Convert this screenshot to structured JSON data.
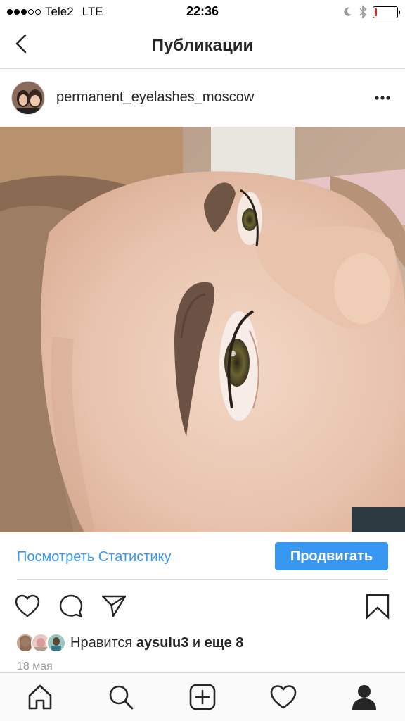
{
  "status_bar": {
    "carrier": "Tele2",
    "network": "LTE",
    "time": "22:36",
    "battery_level_percent": 10,
    "battery_color": "#e0231f"
  },
  "nav": {
    "back_icon": "chevron-left-icon",
    "title": "Публикации"
  },
  "post": {
    "username": "permanent_eyelashes_moscow",
    "more_icon": "more-horizontal-icon",
    "insights_link": "Посмотреть Статистику",
    "promote_button": "Продвигать",
    "likes_prefix": "Нравится",
    "likes_user": "aysulu3",
    "likes_and": "и",
    "likes_more": "еще 8",
    "date": "18 мая"
  },
  "actions": [
    "heart-icon",
    "comment-icon",
    "share-icon",
    "bookmark-icon"
  ],
  "tabbar": [
    "home-icon",
    "search-icon",
    "add-icon",
    "activity-heart-icon",
    "profile-icon"
  ],
  "colors": {
    "accent": "#3897f0",
    "text": "#262626",
    "divider": "#dbdbdb"
  }
}
